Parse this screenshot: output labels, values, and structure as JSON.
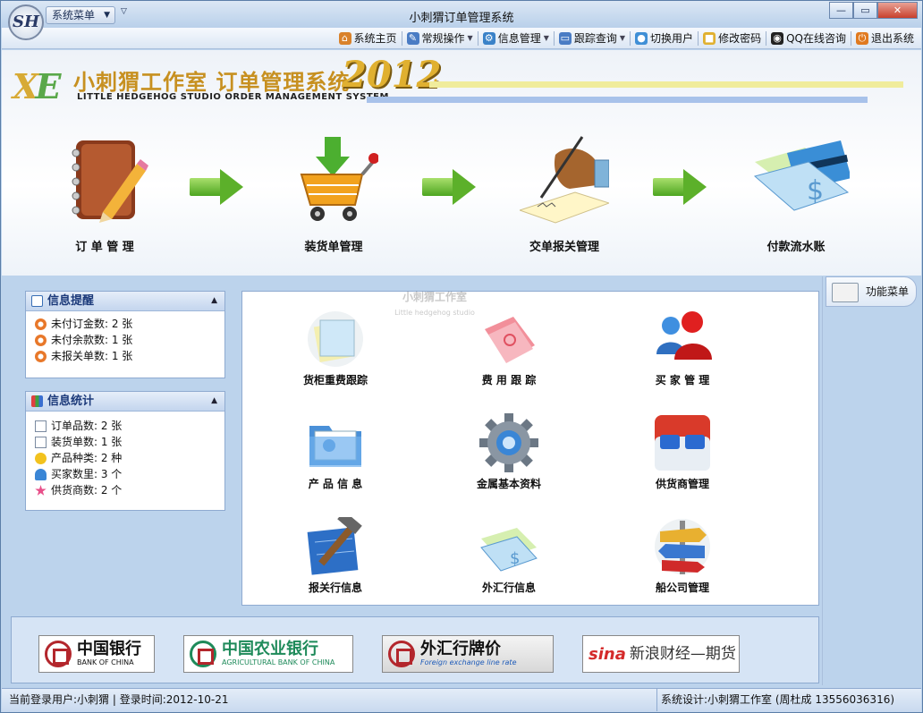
{
  "window": {
    "title": "小刺猬订单管理系统",
    "logo_text": "SH",
    "system_menu_label": "系统菜单",
    "controls": {
      "minimize": "—",
      "maximize": "▭",
      "close": "✕"
    }
  },
  "toolbar": {
    "items": [
      {
        "label": "系统主页",
        "icon": "home-icon",
        "dropdown": false,
        "color": "#d9822b"
      },
      {
        "label": "常规操作",
        "icon": "edit-icon",
        "dropdown": true,
        "color": "#4a7cc4"
      },
      {
        "label": "信息管理",
        "icon": "gear-icon",
        "dropdown": true,
        "color": "#3a82c8"
      },
      {
        "label": "跟踪查询",
        "icon": "monitor-icon",
        "dropdown": true,
        "color": "#4a7cc4"
      },
      {
        "label": "切换用户",
        "icon": "user-icon",
        "dropdown": false,
        "color": "#3f8fd6"
      },
      {
        "label": "修改密码",
        "icon": "lock-icon",
        "dropdown": false,
        "color": "#e0b030"
      },
      {
        "label": "QQ在线咨询",
        "icon": "qq-icon",
        "dropdown": false,
        "color": "#222222"
      },
      {
        "label": "退出系统",
        "icon": "exit-icon",
        "dropdown": false,
        "color": "#e07a20"
      }
    ]
  },
  "banner": {
    "logo_letters": "XE",
    "title_cn": "小刺猬工作室 订单管理系统",
    "title_en": "LITTLE HEDGEHOG STUDIO ORDER MANAGEMENT SYSTEM",
    "year": "2012",
    "steps": [
      {
        "label": "订 单 管 理",
        "icon": "notebook-pencil-icon"
      },
      {
        "label": "装货单管理",
        "icon": "shopping-cart-icon"
      },
      {
        "label": "交单报关管理",
        "icon": "signing-hand-icon"
      },
      {
        "label": "付款流水账",
        "icon": "cheque-card-icon"
      }
    ]
  },
  "info_alert": {
    "title": "信息提醒",
    "rows": [
      {
        "label": "未付订金数: 2 张",
        "icon": "alert-circle-icon"
      },
      {
        "label": "未付余款数: 1 张",
        "icon": "alert-circle-icon"
      },
      {
        "label": "未报关单数: 1 张",
        "icon": "alert-circle-icon"
      }
    ]
  },
  "info_stats": {
    "title": "信息统计",
    "rows": [
      {
        "label": "订单品数: 2 张",
        "icon": "document-icon"
      },
      {
        "label": "装货单数: 1 张",
        "icon": "document-icon"
      },
      {
        "label": "产品种类: 2 种",
        "icon": "lightbulb-icon"
      },
      {
        "label": "买家数里: 3 个",
        "icon": "person-icon"
      },
      {
        "label": "供货商数: 2 个",
        "icon": "star-icon"
      }
    ]
  },
  "watermark": {
    "title": "小刺猬工作室",
    "subtitle": "Little hedgehog studio"
  },
  "tiles": [
    {
      "label": "货柜重费跟踪",
      "icon": "sticky-notes-icon"
    },
    {
      "label": "费 用 跟 踪",
      "icon": "pink-folder-icon"
    },
    {
      "label": "买 家 管 理",
      "icon": "users-icon"
    },
    {
      "label": "产 品 信 息",
      "icon": "blue-folder-icon"
    },
    {
      "label": "金属基本资料",
      "icon": "gear-icon"
    },
    {
      "label": "供货商管理",
      "icon": "glasses-icon"
    },
    {
      "label": "报关行信息",
      "icon": "blueprint-hammer-icon"
    },
    {
      "label": "外汇行信息",
      "icon": "cheque-icon"
    },
    {
      "label": "船公司管理",
      "icon": "signpost-icon"
    }
  ],
  "right_panel": {
    "function_menu_label": "功能菜单"
  },
  "banks": [
    {
      "cn": "中国银行",
      "en": "BANK OF CHINA",
      "color": "#b3262c"
    },
    {
      "cn": "中国农业银行",
      "en": "AGRICULTURAL BANK OF CHINA",
      "color": "#1e8a5a"
    },
    {
      "cn": "外汇行牌价",
      "en": "Foreign exchange line rate",
      "color": "#b3262c"
    },
    {
      "cn": "新浪财经—期货",
      "en": "",
      "color": "#d42a2a"
    }
  ],
  "status": {
    "left": "当前登录用户:小刺猬  | 登录时间:2012-10-21",
    "right": "系统设计:小刺猬工作室  (周杜成 13556036316)"
  }
}
